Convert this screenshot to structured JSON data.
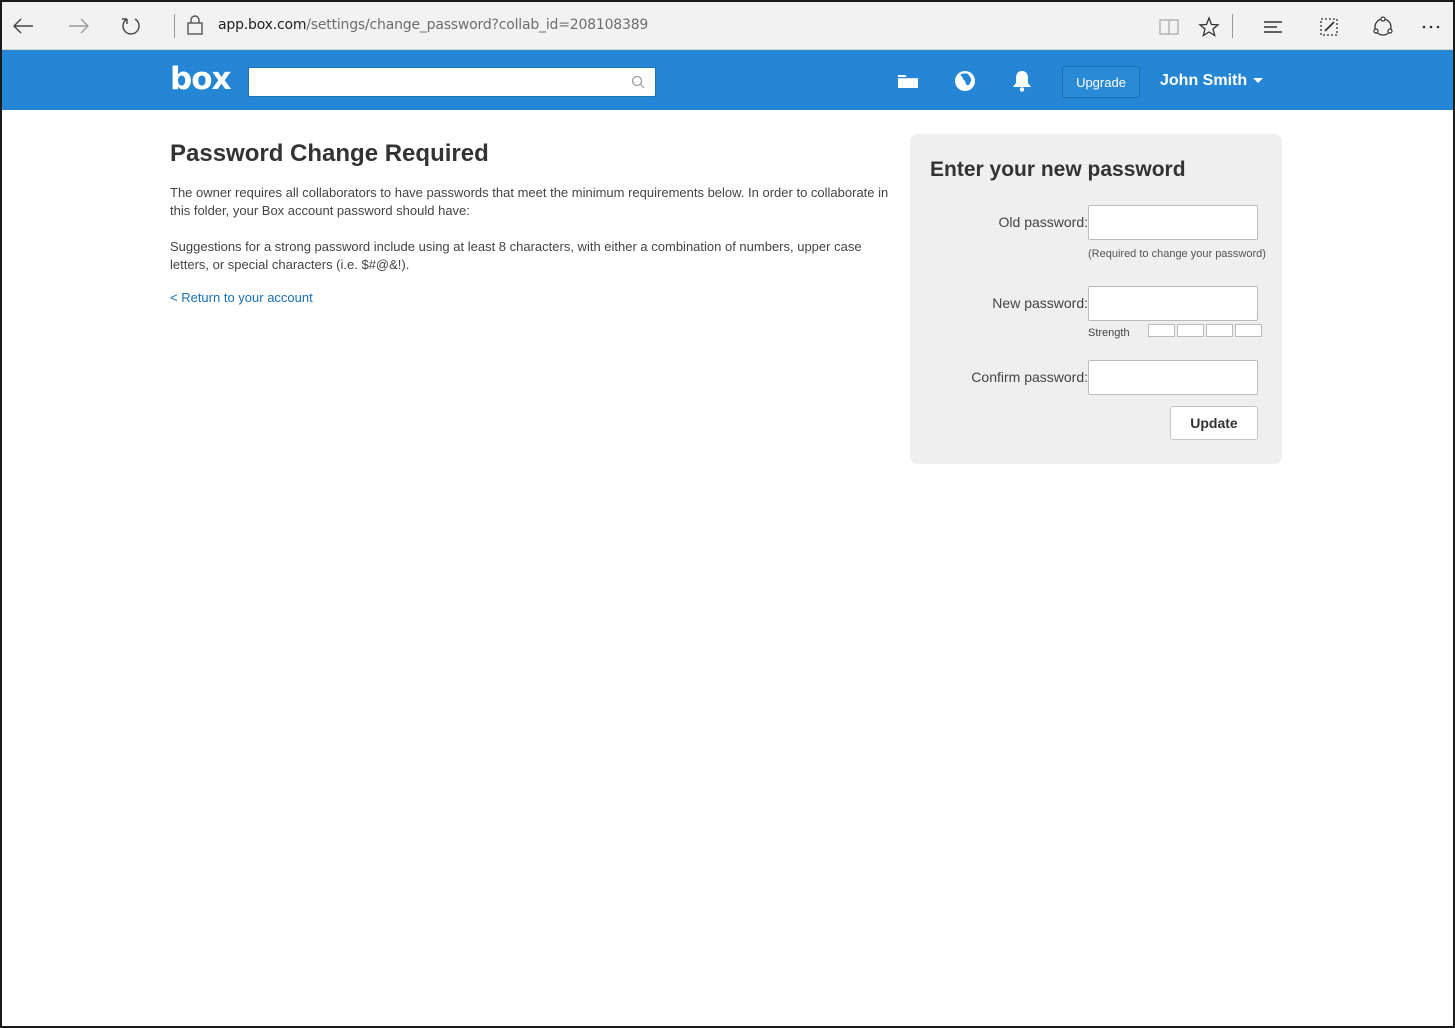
{
  "browser": {
    "url_host": "app.box.com",
    "url_path": "/settings/change_password?collab_id=208108389",
    "icons": [
      "back-icon",
      "forward-icon",
      "refresh-icon",
      "lock-icon",
      "reading-view-icon",
      "favorite-star-icon",
      "hub-icon",
      "web-note-icon",
      "share-icon",
      "more-icon"
    ]
  },
  "header": {
    "logo": "box",
    "search_placeholder": "",
    "upgrade_label": "Upgrade",
    "user_name": "John Smith",
    "icons": [
      "folder-icon",
      "globe-icon",
      "bell-icon"
    ],
    "brand_color": "#2486d4"
  },
  "main": {
    "title": "Password Change Required",
    "paragraph1": "The owner requires all collaborators to have passwords that meet the minimum requirements below. In order to collaborate in this folder, your Box account password should have:",
    "paragraph2": "Suggestions for a strong password include using at least 8 characters, with either a combination of numbers, upper case letters, or special characters (i.e. $#@&!).",
    "return_link": "< Return to your account"
  },
  "form": {
    "title": "Enter your new password",
    "old_label": "Old password:",
    "old_value": "",
    "old_hint": "(Required to change your password)",
    "new_label": "New password:",
    "new_value": "",
    "strength_label": "Strength",
    "confirm_label": "Confirm password:",
    "confirm_value": "",
    "update_label": "Update"
  }
}
